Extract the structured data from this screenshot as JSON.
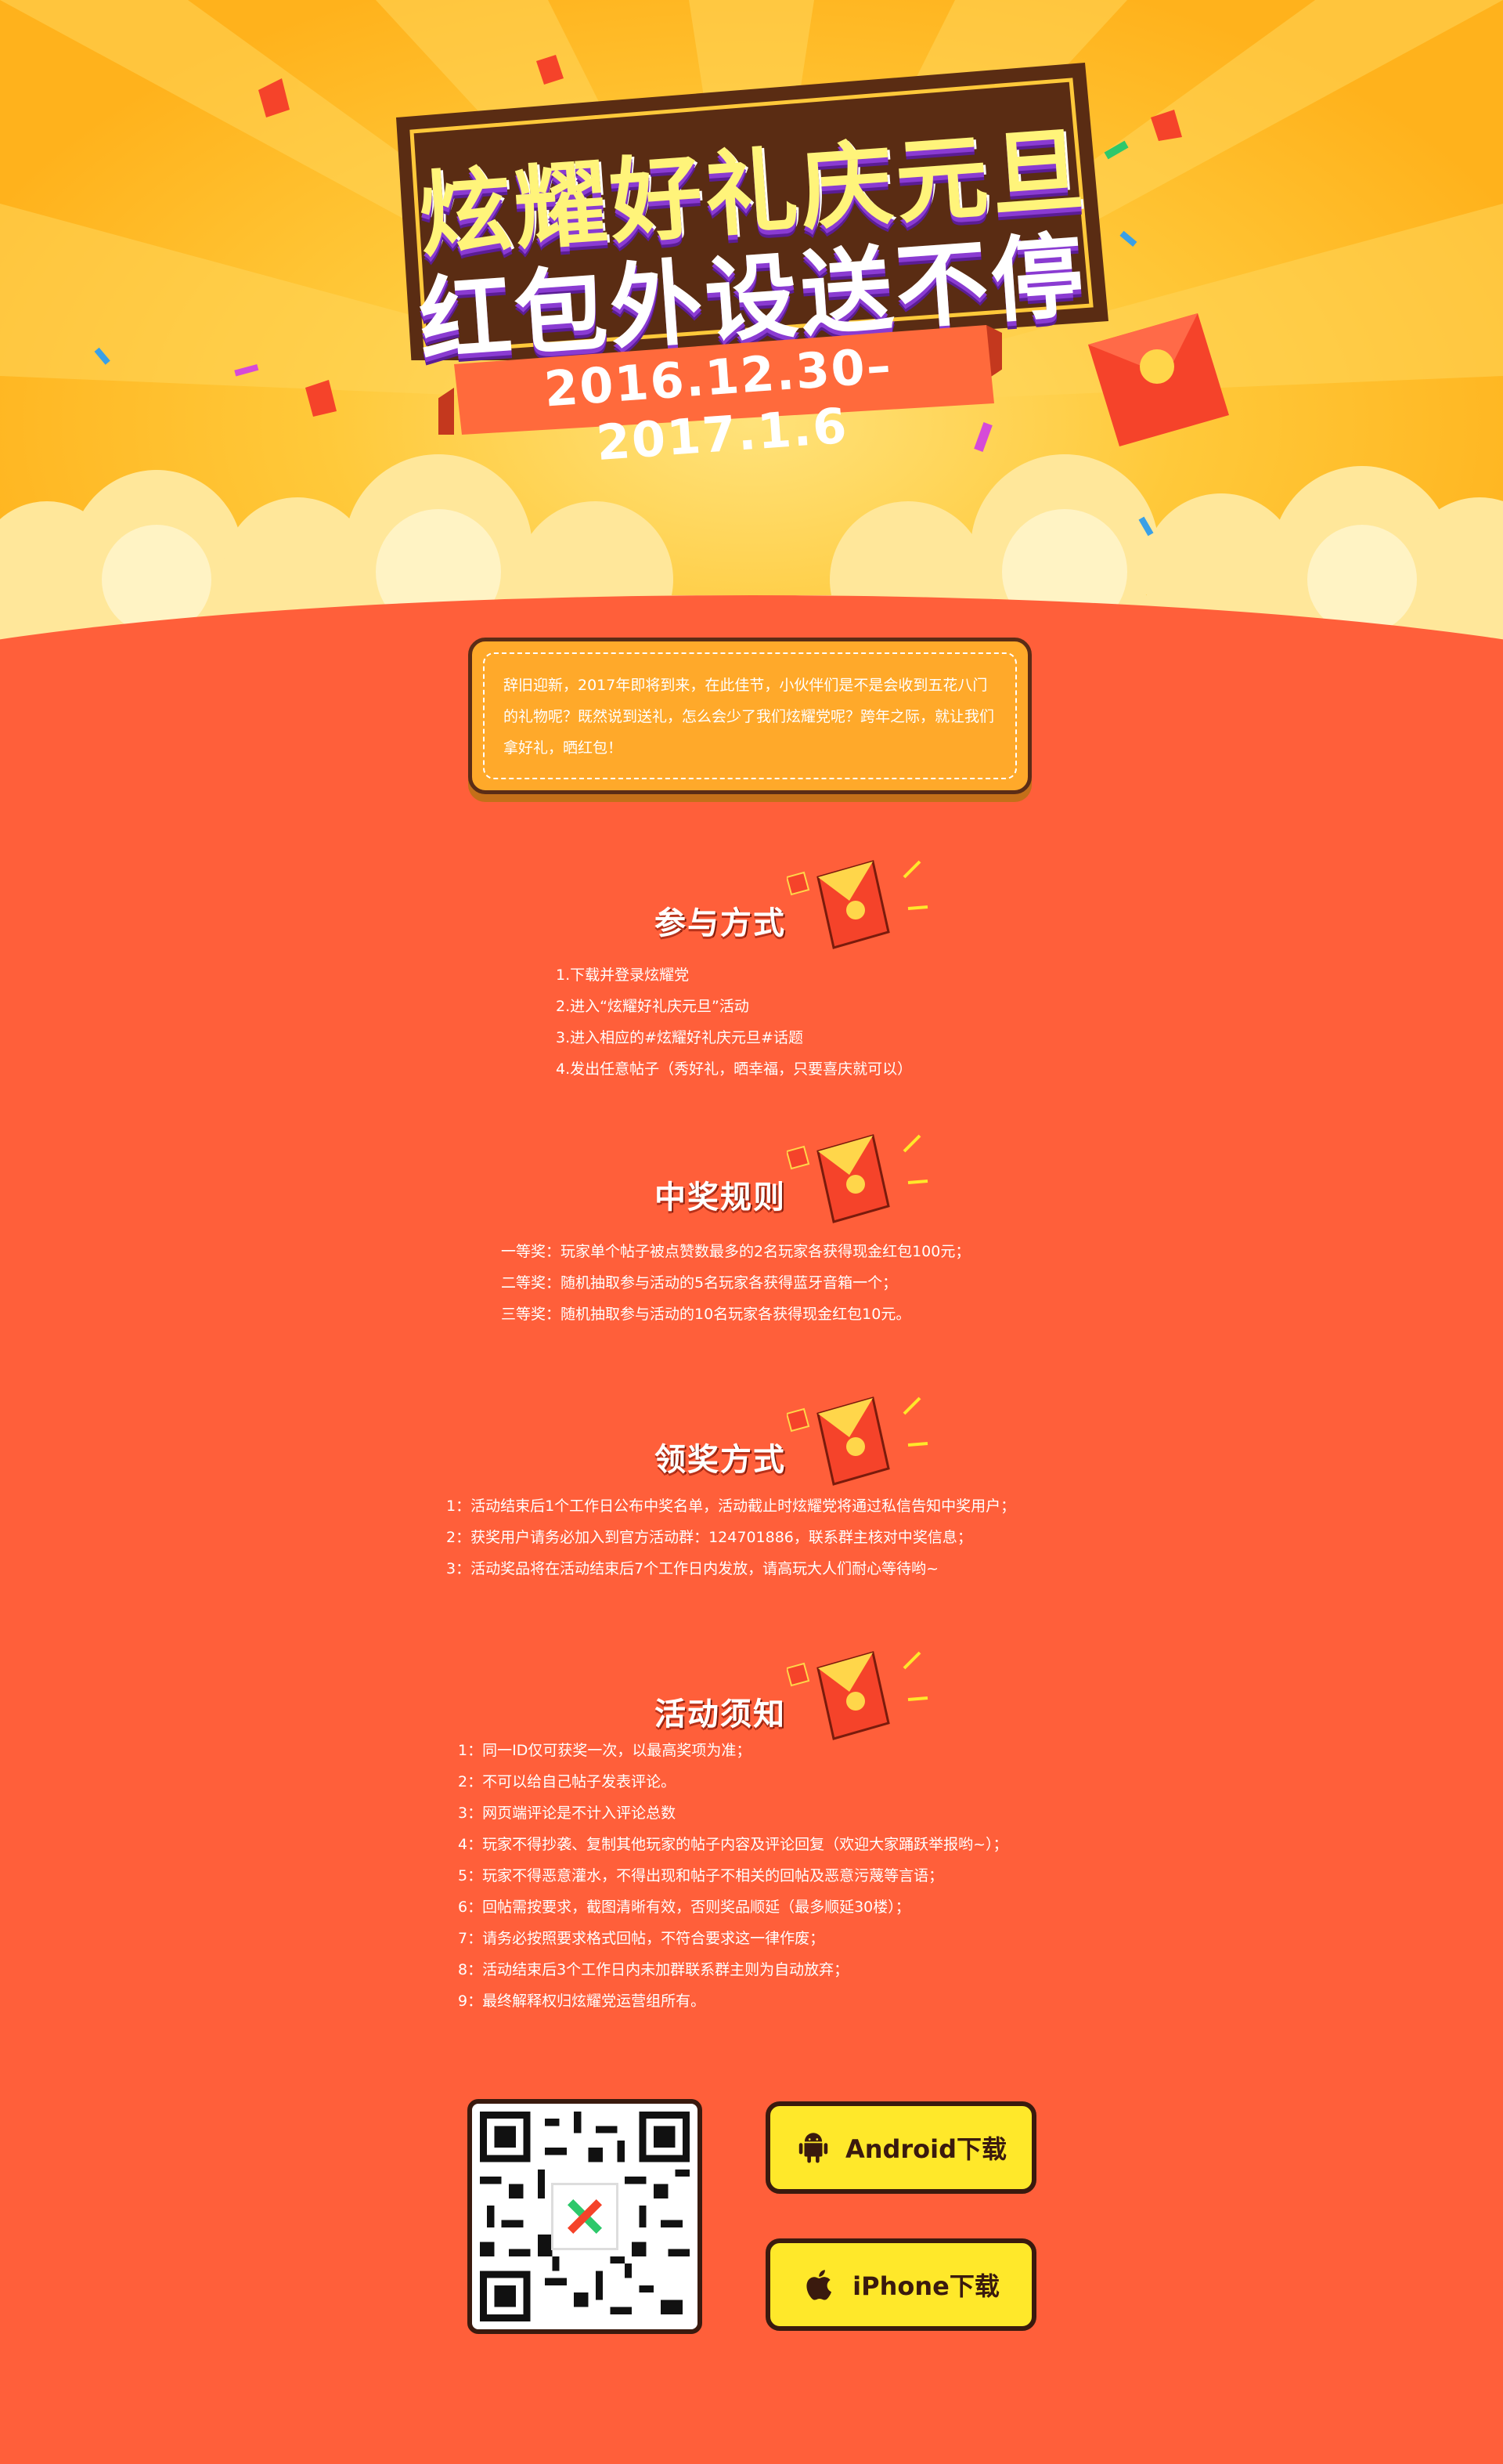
{
  "hero": {
    "title_line1": "炫耀好礼庆元旦",
    "title_line2": "红包外设送不停",
    "date_range": "2016.12.30–2017.1.6"
  },
  "intro": {
    "text": "辞旧迎新，2017年即将到来，在此佳节，小伙伴们是不是会收到五花八门的礼物呢？既然说到送礼，怎么会少了我们炫耀党呢？跨年之际，就让我们拿好礼，晒红包！"
  },
  "sections": {
    "participate": {
      "title": "参与方式",
      "items": [
        "1.下载并登录炫耀党",
        "2.进入“炫耀好礼庆元旦”活动",
        "3.进入相应的#炫耀好礼庆元旦#话题",
        "4.发出任意帖子（秀好礼，晒幸福，只要喜庆就可以）"
      ]
    },
    "rules": {
      "title": "中奖规则",
      "items": [
        "一等奖：玩家单个帖子被点赞数最多的2名玩家各获得现金红包100元；",
        "二等奖：随机抽取参与活动的5名玩家各获得蓝牙音箱一个；",
        "三等奖：随机抽取参与活动的10名玩家各获得现金红包10元。"
      ]
    },
    "claim": {
      "title": "领奖方式",
      "items": [
        "1：活动结束后1个工作日公布中奖名单，活动截止时炫耀党将通过私信告知中奖用户；",
        "2：获奖用户请务必加入到官方活动群：124701886，联系群主核对中奖信息；",
        "3：活动奖品将在活动结束后7个工作日内发放，请高玩大人们耐心等待哟~"
      ]
    },
    "notice": {
      "title": "活动须知",
      "items": [
        "1：同一ID仅可获奖一次，以最高奖项为准；",
        "2：不可以给自己帖子发表评论。",
        "3：网页端评论是不计入评论总数",
        "4：玩家不得抄袭、复制其他玩家的帖子内容及评论回复（欢迎大家踊跃举报哟~）；",
        "5：玩家不得恶意灌水，不得出现和帖子不相关的回帖及恶意污蔑等言语；",
        "6：回帖需按要求，截图清晰有效，否则奖品顺延（最多顺延30楼）；",
        "7：请务必按照要求格式回帖，不符合要求这一律作废；",
        "8：活动结束后3个工作日内未加群联系群主则为自动放弃；",
        "9：最终解释权归炫耀党运营组所有。"
      ]
    }
  },
  "download": {
    "android_label": "Android下载",
    "iphone_label": "iPhone下载"
  },
  "colors": {
    "bg_orange": "#ff5f3a",
    "hero_yellow": "#ffc93a",
    "button_yellow": "#ffe82a",
    "border_brown": "#3a1a0e"
  },
  "icons": [
    "android-icon",
    "apple-icon",
    "red-envelope-icon",
    "qr-code"
  ]
}
